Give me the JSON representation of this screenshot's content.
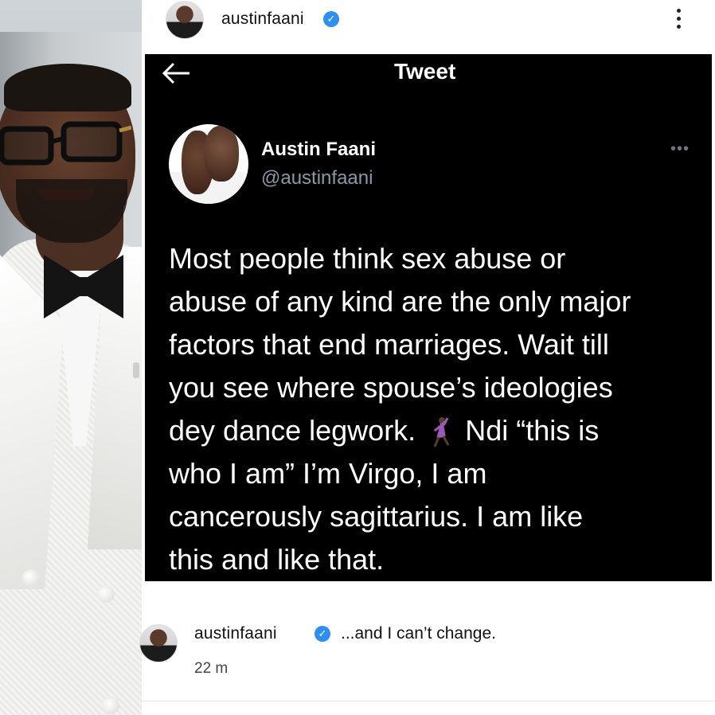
{
  "post_header": {
    "username": "austinfaani",
    "verified_icon": "verified-badge-icon",
    "menu_icon": "more-vertical-icon"
  },
  "tweet": {
    "header_title": "Tweet",
    "back_icon": "arrow-left-icon",
    "author_name": "Austin Faani",
    "author_handle": "@austinfaani",
    "more_icon": "more-horizontal-icon",
    "text_part1": "Most people think sex abuse or\nabuse of any kind are the only major\nfactors that end marriages. Wait till\nyou see where spouse’s ideologies\ndey dance legwork.",
    "emoji_icon": "woman-dancing-icon",
    "text_part2": "Ndi “this is\nwho I am” I’m Virgo, I am\ncancerously sagittarius. I am like\nthis and like that."
  },
  "caption": {
    "username": "austinfaani",
    "text": "...and I can’t change.",
    "time": "22 m"
  },
  "colors": {
    "tweet_bg": "#000000",
    "handle_gray": "#8b98a5",
    "verified_blue": "#2f8ff0"
  }
}
